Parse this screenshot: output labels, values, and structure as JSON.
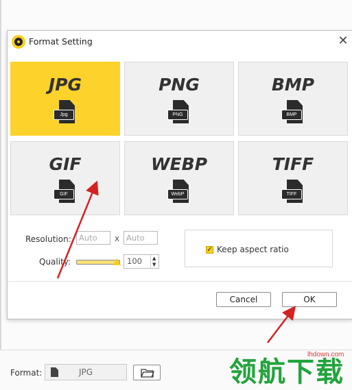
{
  "dialog": {
    "title": "Format Setting",
    "close_glyph": "✕",
    "formats": [
      {
        "name": "JPG",
        "badge": "Jpg",
        "selected": true
      },
      {
        "name": "PNG",
        "badge": "PNG",
        "selected": false
      },
      {
        "name": "BMP",
        "badge": "BMP",
        "selected": false
      },
      {
        "name": "GIF",
        "badge": "GIF",
        "selected": false
      },
      {
        "name": "WEBP",
        "badge": "WebP",
        "selected": false
      },
      {
        "name": "TIFF",
        "badge": "TIFF",
        "selected": false
      }
    ],
    "resolution": {
      "label": "Resolution:",
      "width_placeholder": "Auto",
      "separator": "x",
      "height_placeholder": "Auto"
    },
    "quality": {
      "label": "Quality:",
      "value": "100",
      "level_percent": 100
    },
    "keep_aspect": {
      "label": "Keep aspect ratio",
      "checked": true
    },
    "buttons": {
      "cancel": "Cancel",
      "ok": "OK"
    }
  },
  "bottom_bar": {
    "format_label": "Format:",
    "format_value": "JPG"
  },
  "watermark": {
    "text": "领航下载",
    "url": "lhdown.com"
  },
  "colors": {
    "accent_yellow": "#fcd22b",
    "annotation_red": "#d42121"
  }
}
